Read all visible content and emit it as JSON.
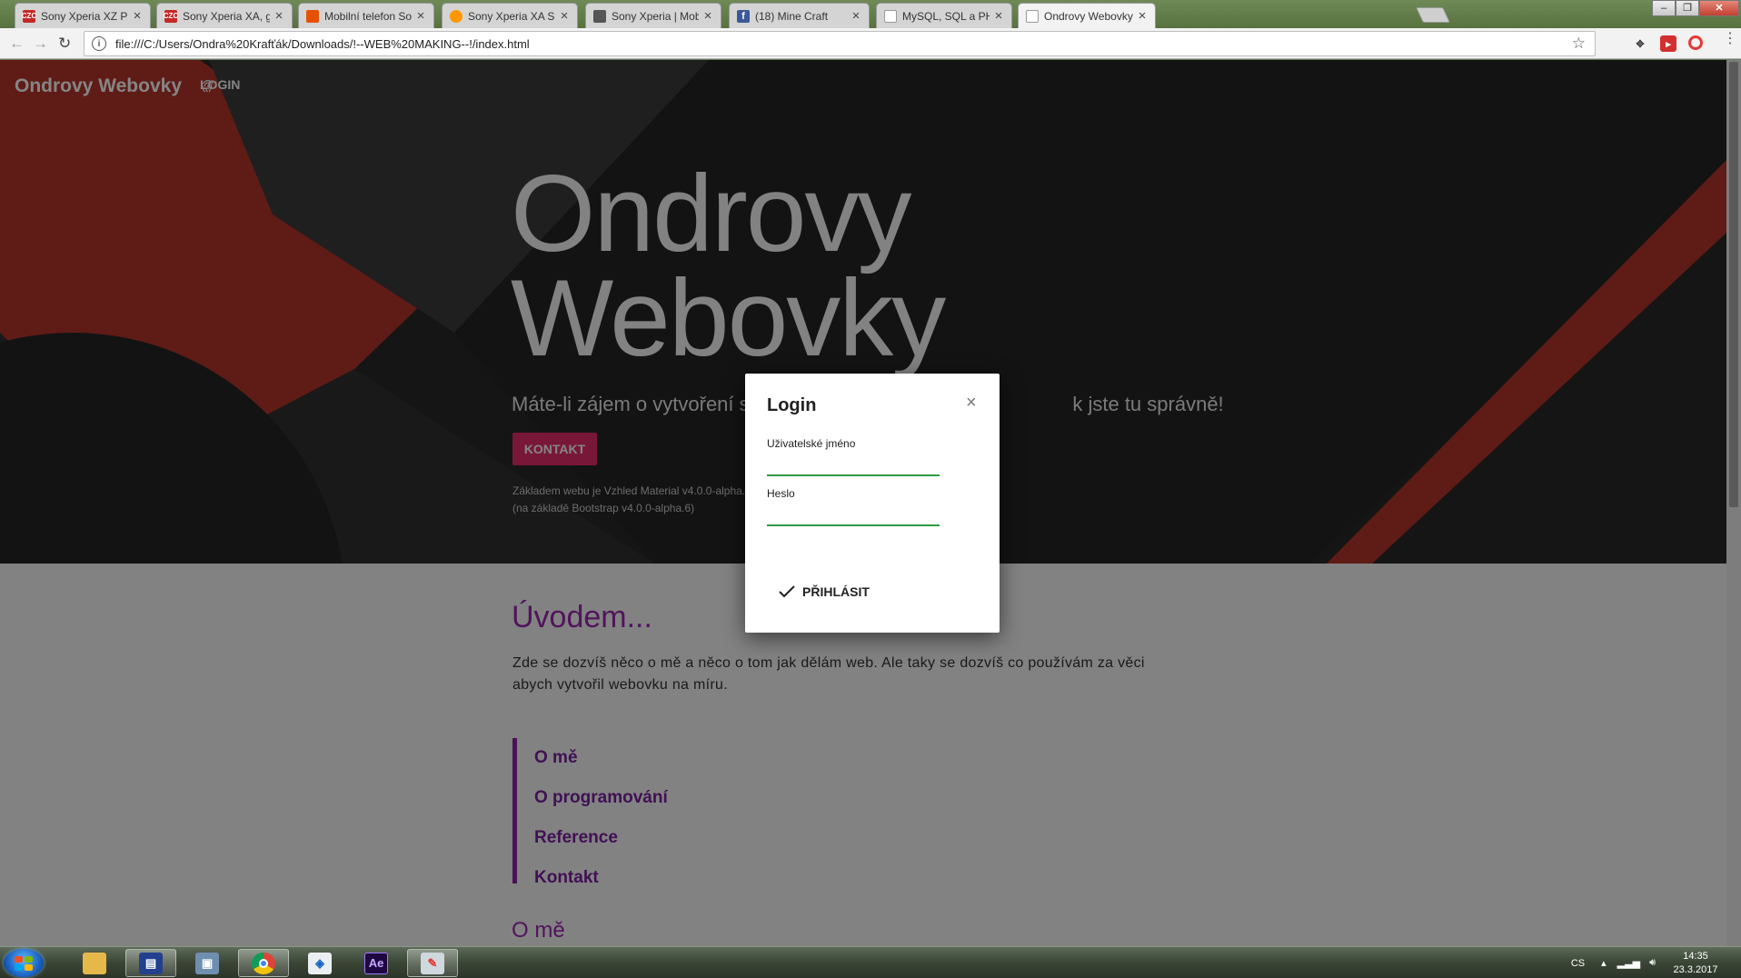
{
  "browser": {
    "tabs": [
      {
        "title": "Sony Xperia XZ Premium",
        "favicon": "czc-icon",
        "favicon_text": "CZC",
        "favicon_color": "#c62828",
        "active": false
      },
      {
        "title": "Sony Xperia XA, grafitov",
        "favicon": "czc-icon",
        "favicon_text": "CZC",
        "favicon_color": "#c62828",
        "active": false
      },
      {
        "title": "Mobilní telefon Sony Xpe",
        "favicon": "shop-icon",
        "favicon_text": "",
        "favicon_color": "#e65100",
        "active": false
      },
      {
        "title": "Sony Xperia XA Single SI",
        "favicon": "heureka-icon",
        "favicon_text": "",
        "favicon_color": "#ff9800",
        "active": false
      },
      {
        "title": "Sony Xperia | Mobil se z",
        "favicon": "page-icon",
        "favicon_text": "",
        "favicon_color": "#555555",
        "active": false
      },
      {
        "title": "(18) Mine Craft",
        "favicon": "facebook-icon",
        "favicon_text": "f",
        "favicon_color": "#3b5998",
        "active": false
      },
      {
        "title": "MySQL, SQL a PHP",
        "favicon": "document-icon",
        "favicon_text": "",
        "favicon_color": "#9e9e9e",
        "active": false
      },
      {
        "title": "Ondrovy Webovky",
        "favicon": "document-icon",
        "favicon_text": "",
        "favicon_color": "#9e9e9e",
        "active": true
      }
    ],
    "url": "file:///C:/Users/Ondra%20Krafťák/Downloads/!--WEB%20MAKING--!/index.html"
  },
  "navbar": {
    "brand": "Ondrovy Webovky",
    "login_label": "LOGIN"
  },
  "hero": {
    "title_line1": "Ondrovy",
    "title_line2": "Webovky",
    "subtitle": "Máte-li zájem o vytvoření str                                                        k jste tu správně!",
    "cta_label": "KONTAKT",
    "note_line1": "Základem webu je Vzhled Material v4.0.0-alpha.",
    "note_line2": "(na základě Bootstrap v4.0.0-alpha.6)"
  },
  "intro": {
    "heading": "Úvodem...",
    "text": "Zde se dozvíš něco o mě a něco o tom jak dělám web. Ale taky se dozvíš co používám za věci abych vytvořil webovku na míru.",
    "links": [
      "O mě",
      "O programování",
      "Reference",
      "Kontakt"
    ],
    "next_section_heading": "O mě"
  },
  "login_modal": {
    "title": "Login",
    "close_glyph": "×",
    "username_label": "Uživatelské jméno",
    "username_value": "",
    "password_label": "Heslo",
    "password_value": "",
    "submit_label": "PŘIHLÁSIT"
  },
  "taskbar": {
    "apps": [
      "explorer-icon",
      "save-icon",
      "network-icon",
      "chrome-icon",
      "security-icon",
      "after-effects-icon",
      "paint-icon"
    ],
    "after_effects_label": "Ae",
    "language": "CS",
    "time": "14:35",
    "date": "23.3.2017"
  },
  "colors": {
    "accent_pink": "#e92c6c",
    "purple": "#9c27b0",
    "input_underline": "#2e9c42",
    "hero_red": "#b7352b"
  }
}
